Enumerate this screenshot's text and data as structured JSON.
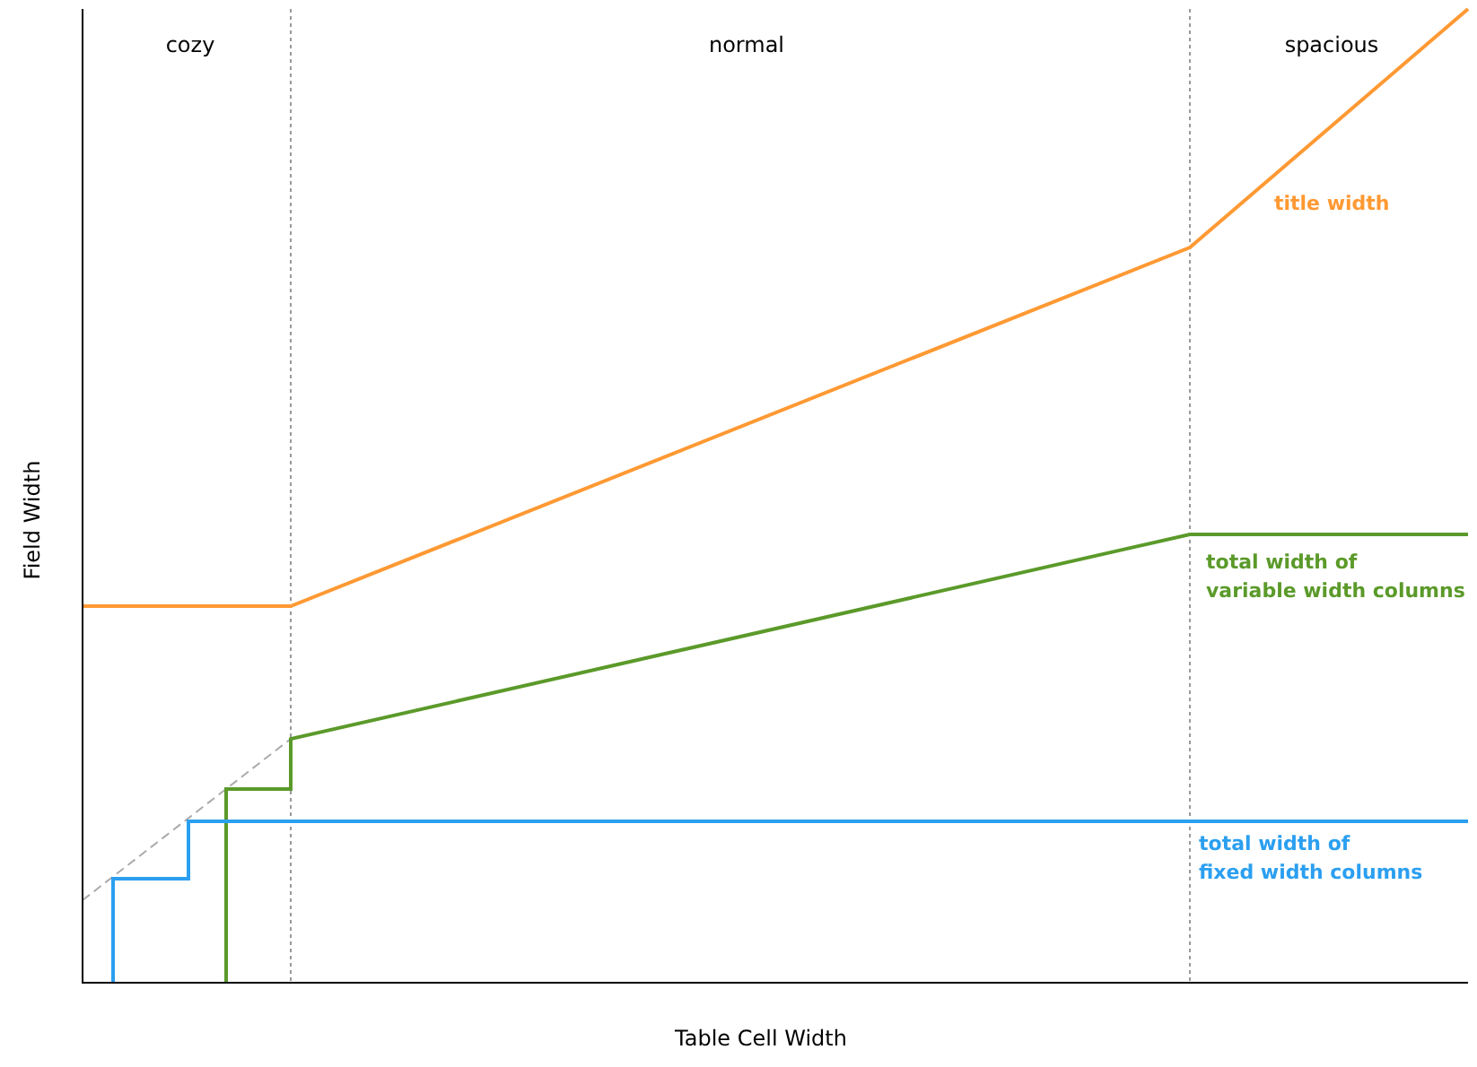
{
  "chart": {
    "xlabel": "Table Cell Width",
    "ylabel": "Field Width",
    "regions": [
      {
        "label": "cozy"
      },
      {
        "label": "normal"
      },
      {
        "label": "spacious"
      }
    ],
    "series": [
      {
        "label_lines": [
          "title width"
        ],
        "color": "#ff9933"
      },
      {
        "label_lines": [
          "total width of",
          "variable width columns"
        ],
        "color": "#5b9a2a"
      },
      {
        "label_lines": [
          "total width of",
          "fixed width columns"
        ],
        "color": "#2b9ff0"
      }
    ]
  }
}
